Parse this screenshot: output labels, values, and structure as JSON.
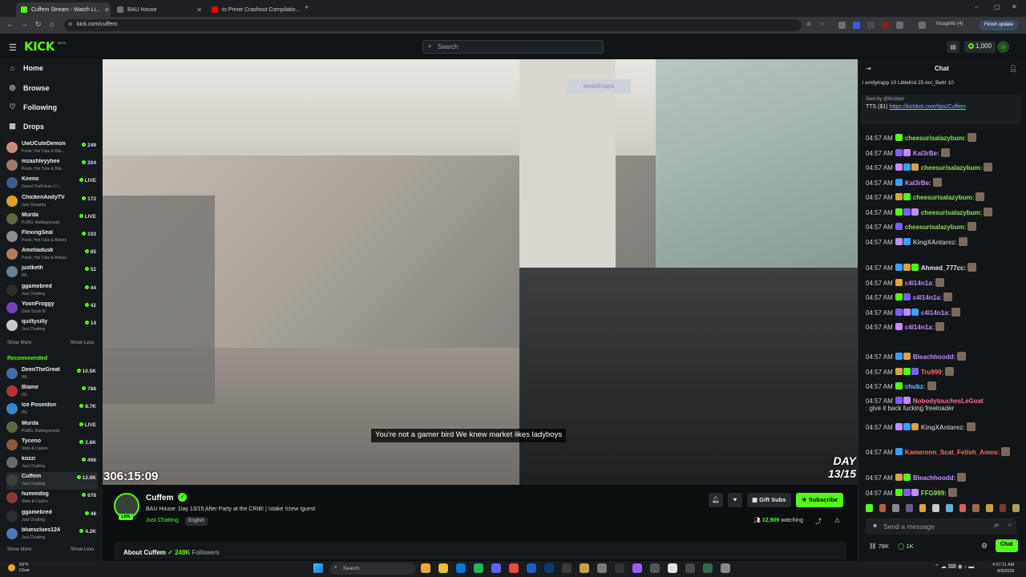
{
  "browser": {
    "tabs": [
      {
        "title": "Cuffem Stream - Watch Li...",
        "active": true,
        "color": "#53fc18"
      },
      {
        "title": "BAU House",
        "active": false,
        "color": "#6b6f75"
      },
      {
        "title": "to Prime Crashout Compilatio...",
        "active": false,
        "color": "#ff0000"
      }
    ],
    "url": "kick.com/cuffem",
    "incognito_label": "Incognito (4)",
    "finish_update_label": "Finish update"
  },
  "header": {
    "logo": "KICK",
    "beta": "BETA",
    "search_placeholder": "Search",
    "points": "1,000"
  },
  "sidebar": {
    "nav": [
      {
        "label": "Home",
        "icon": "home-icon"
      },
      {
        "label": "Browse",
        "icon": "compass-icon"
      },
      {
        "label": "Following",
        "icon": "heart-icon"
      },
      {
        "label": "Drops",
        "icon": "drops-icon"
      }
    ],
    "following": [
      {
        "name": "UwUCuteDemon",
        "category": "Pools, Hot Tubs & Biki...",
        "viewers": "249",
        "color": "#c98b7e"
      },
      {
        "name": "mzashleyybee",
        "category": "Pools, Hot Tubs & Biki...",
        "viewers": "204",
        "color": "#a07a6a"
      },
      {
        "name": "Keeno",
        "category": "Grand Theft Auto V l...",
        "viewers": "LIVE",
        "color": "#3d5c8a"
      },
      {
        "name": "ChickenAndyTV",
        "category": "Just Sleeping",
        "viewers": "172",
        "color": "#e0a020"
      },
      {
        "name": "Murda",
        "category": "PUBG: Battlegrounds",
        "viewers": "LIVE",
        "color": "#5a6a3a"
      },
      {
        "name": "FlexingSeal",
        "category": "Pools, Hot Tubs & Bikinis",
        "viewers": "103",
        "color": "#8c8c8c"
      },
      {
        "name": "Ameliadusk",
        "category": "Pools, Hot Tubs & Bikinis",
        "viewers": "85",
        "color": "#b87a5c"
      },
      {
        "name": "justketh",
        "category": "IRL",
        "viewers": "52",
        "color": "#6b7f8f"
      },
      {
        "name": "ggamebred",
        "category": "Just Chatting",
        "viewers": "44",
        "color": "#2d2d2d"
      },
      {
        "name": "YoonFroggy",
        "category": "Dark Souls III",
        "viewers": "42",
        "color": "#7a3fb8"
      },
      {
        "name": "quiltysilly",
        "category": "Just Chatting",
        "viewers": "14",
        "color": "#c9c9c9"
      }
    ],
    "show_more": "Show More",
    "show_less": "Show Less",
    "recommended_title": "Recommended",
    "recommended": [
      {
        "name": "DeenTheGreat",
        "category": "IRL",
        "viewers": "10.5K",
        "color": "#3d6fa8",
        "selected": false
      },
      {
        "name": "Blame",
        "category": "IRL",
        "viewers": "788",
        "color": "#b83232",
        "selected": false
      },
      {
        "name": "Ice Poseidon",
        "category": "IRL",
        "viewers": "8.7K",
        "color": "#2f8ad6",
        "selected": false
      },
      {
        "name": "Murda",
        "category": "PUBG: Battlegrounds",
        "viewers": "LIVE",
        "color": "#5a6a3a",
        "selected": false
      },
      {
        "name": "Tyceno",
        "category": "Slots & Casino",
        "viewers": "2.6K",
        "color": "#8a5a3a",
        "selected": false
      },
      {
        "name": "kozzi",
        "category": "Just Chatting",
        "viewers": "496",
        "color": "#6a6a6a",
        "selected": false
      },
      {
        "name": "Cuffem",
        "category": "Just Chatting",
        "viewers": "12.9K",
        "color": "#3b3f3a",
        "selected": true
      },
      {
        "name": "hummdog",
        "category": "Slots & Casino",
        "viewers": "678",
        "color": "#8a3a3a",
        "selected": false
      },
      {
        "name": "ggamebred",
        "category": "Just Chatting",
        "viewers": "48",
        "color": "#2d2d2d",
        "selected": false
      },
      {
        "name": "bluesclues124",
        "category": "Just Chatting",
        "viewers": "4.2K",
        "color": "#4a7ab8",
        "selected": false
      }
    ]
  },
  "video": {
    "subtitle": "You're not a gamer bird We knew market likes ladyboys",
    "uptime": "306:15:09",
    "day_badge_line1": "DAY",
    "day_badge_line2": "13/15",
    "sponsor": "weedmaps"
  },
  "stream": {
    "streamer": "Cuffem",
    "live_label": "LIVE",
    "title": "BAU House: Day 13/15 After Party at the CRIB! | !stake !crew !guest",
    "category": "Just Chatting",
    "tag": "English",
    "gift_subs_label": "Gift Subs",
    "subscribe_label": "Subscribe",
    "viewers": "12,909",
    "watching_label": "watching",
    "about_label": "About Cuffem",
    "followers": "248K",
    "followers_label": "Followers"
  },
  "chat": {
    "title": "Chat",
    "top_gifters": "l emilytrapp 10   LittleKid 25   Arc_Bettr 10",
    "pinned_sent_by": "Sent by @Kickbot",
    "pinned_text": "TTS ($1)",
    "pinned_link": "https://kickbot.com/tips/Cuffem",
    "messages": [
      {
        "time": "04:57 AM",
        "user": "cheesurisalazybum:",
        "color": "#8ee05a",
        "text": ""
      },
      {
        "time": "04:57 AM",
        "user": "Kal3rBe:",
        "color": "#c38cff",
        "text": ""
      },
      {
        "time": "04:57 AM",
        "user": "cheesurisalazybum:",
        "color": "#8ee05a",
        "text": ""
      },
      {
        "time": "04:57 AM",
        "user": "Kal3rBe:",
        "color": "#c38cff",
        "text": ""
      },
      {
        "time": "04:57 AM",
        "user": "cheesurisalazybum:",
        "color": "#8ee05a",
        "text": ""
      },
      {
        "time": "04:57 AM",
        "user": "cheesurisalazybum:",
        "color": "#8ee05a",
        "text": ""
      },
      {
        "time": "04:57 AM",
        "user": "cheesurisalazybum:",
        "color": "#8ee05a",
        "text": ""
      },
      {
        "time": "04:57 AM",
        "user": "KingXAntarez:",
        "color": "#b0b0b0",
        "text": ""
      },
      {
        "time": "04:57 AM",
        "user": "Ahmed_777cc:",
        "color": "#e6e6e6",
        "text": ""
      },
      {
        "time": "04:57 AM",
        "user": "c4l14n1a:",
        "color": "#c38cff",
        "text": ""
      },
      {
        "time": "04:57 AM",
        "user": "c4l14n1a:",
        "color": "#c38cff",
        "text": ""
      },
      {
        "time": "04:57 AM",
        "user": "c4l14n1a:",
        "color": "#c38cff",
        "text": ""
      },
      {
        "time": "04:57 AM",
        "user": "c4l14n1a:",
        "color": "#c38cff",
        "text": ""
      },
      {
        "time": "04:57 AM",
        "user": "Bleachhoodd:",
        "color": "#c38cff",
        "text": ""
      },
      {
        "time": "04:57 AM",
        "user": "Tru999:",
        "color": "#ff6b6b",
        "text": ""
      },
      {
        "time": "04:57 AM",
        "user": "chubz:",
        "color": "#6fc3ff",
        "text": ""
      },
      {
        "time": "04:57 AM",
        "user": "NobodytouchesLeGoat",
        "color": "#ff6b9d",
        "text": "give it back fucking freeloader"
      },
      {
        "time": "04:57 AM",
        "user": "KingXAntarez:",
        "color": "#b0b0b0",
        "text": ""
      },
      {
        "time": "04:57 AM",
        "user": "Kameronn_Scat_Fetish_Amos:",
        "color": "#ff6b6b",
        "text": ""
      },
      {
        "time": "04:57 AM",
        "user": "Bleachhoodd:",
        "color": "#c38cff",
        "text": ""
      },
      {
        "time": "04:57 AM",
        "user": "FFG999:",
        "color": "#8ee05a",
        "text": ""
      }
    ],
    "input_placeholder": "Send a message",
    "stat_a": "78K",
    "stat_b": "1K",
    "send_label": "Chat"
  },
  "taskbar": {
    "weather_temp": "69°F",
    "weather_desc": "Clear",
    "search_placeholder": "Search",
    "time": "4:57:11 AM",
    "date": "8/8/2026"
  }
}
